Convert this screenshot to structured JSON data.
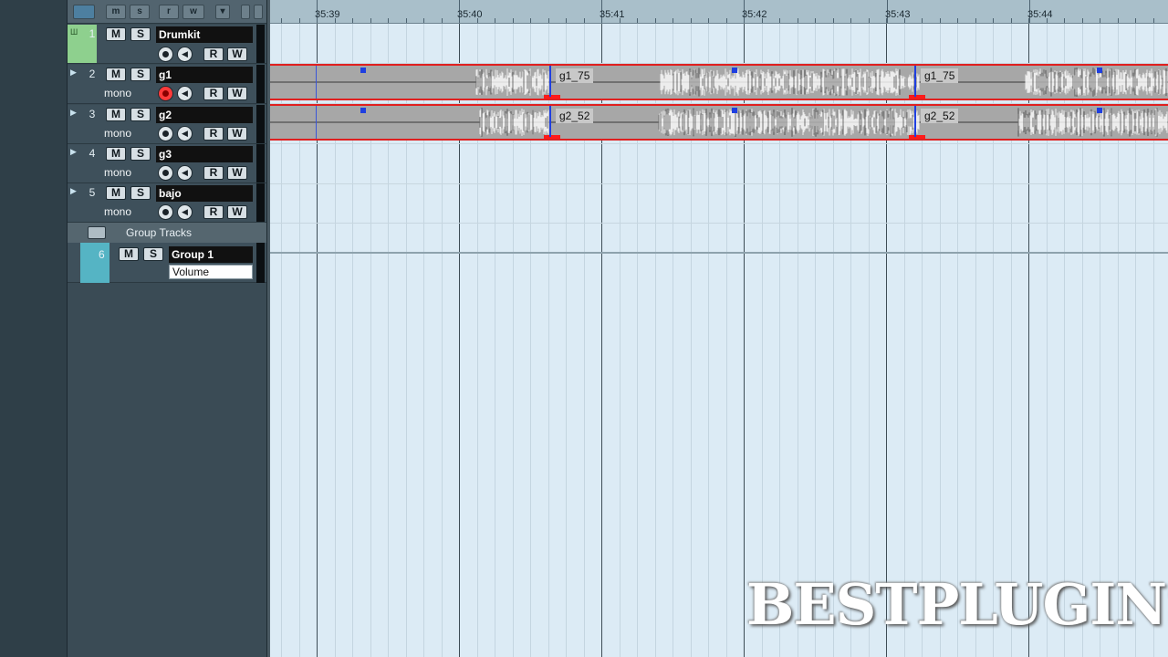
{
  "ruler": {
    "markers": [
      "35:39",
      "35:40",
      "35:41",
      "35:42",
      "35:43",
      "35:44"
    ]
  },
  "toolbar": {
    "buttons": [
      "m",
      "s",
      "r",
      "w"
    ]
  },
  "tracks": [
    {
      "number": "1",
      "name": "Drumkit",
      "mute": "M",
      "solo": "S",
      "read": "R",
      "write": "W",
      "mode": ""
    },
    {
      "number": "2",
      "name": "g1",
      "mute": "M",
      "solo": "S",
      "read": "R",
      "write": "W",
      "mode": "mono"
    },
    {
      "number": "3",
      "name": "g2",
      "mute": "M",
      "solo": "S",
      "read": "R",
      "write": "W",
      "mode": "mono"
    },
    {
      "number": "4",
      "name": "g3",
      "mute": "M",
      "solo": "S",
      "read": "R",
      "write": "W",
      "mode": "mono"
    },
    {
      "number": "5",
      "name": "bajo",
      "mute": "M",
      "solo": "S",
      "read": "R",
      "write": "W",
      "mode": "mono"
    }
  ],
  "group_folder": {
    "label": "Group Tracks"
  },
  "group_track": {
    "number": "6",
    "name": "Group 1",
    "mute": "M",
    "solo": "S",
    "parameter": "Volume"
  },
  "events": {
    "g1": [
      "g1_75",
      "g1_75"
    ],
    "g2": [
      "g2_52",
      "g2_52"
    ]
  },
  "watermark": "BESTPLUGINS",
  "colors": {
    "drumkit_track": "#8ed08e",
    "group_track": "#55b4c4",
    "event_border": "#e02020",
    "record_armed": "#ff3a3a",
    "arrange_bg": "#dcebf5"
  }
}
